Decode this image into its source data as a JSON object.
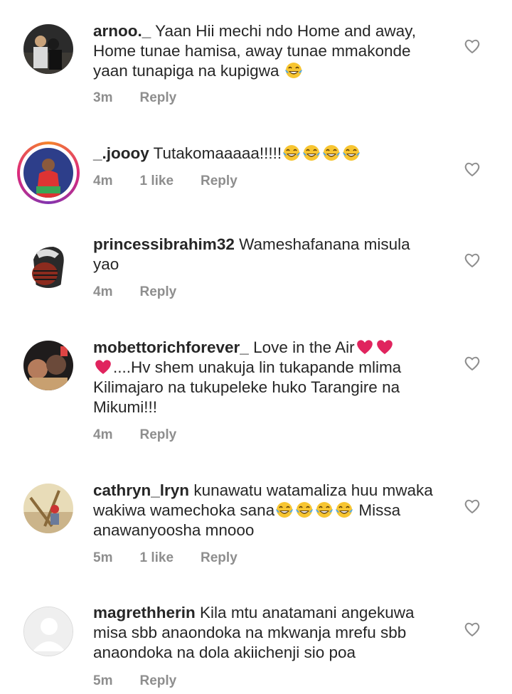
{
  "comments": [
    {
      "username": "arnoo._",
      "text_lines": [
        "Yaan Hii mechi ndo Home and away,",
        "Home tunae hamisa, away tunae mmakonde",
        "yaan tunapiga na kupigwa"
      ],
      "emoji_trailing": [
        "laughing-tears"
      ],
      "time": "3m",
      "likes": "",
      "reply": "Reply"
    },
    {
      "username": "_.joooy",
      "text_lines": [
        "Tutakomaaaaa!!!!!"
      ],
      "emoji_trailing": [
        "laughing-tears",
        "laughing-tears",
        "laughing-tears",
        "laughing-tears"
      ],
      "time": "4m",
      "likes": "1 like",
      "reply": "Reply",
      "has_story_ring": true
    },
    {
      "username": "princessibrahim32",
      "text_lines": [
        "Wameshafanana misula",
        "yao"
      ],
      "time": "4m",
      "likes": "",
      "reply": "Reply"
    },
    {
      "username": "mobettorichforever_",
      "text_lines": [
        "Love in the Air",
        "....Hv shem unakuja lin tukapande mlima",
        "Kilimajaro na tukupeleke huko Tarangire na",
        "Mikumi!!!"
      ],
      "time": "4m",
      "likes": "",
      "reply": "Reply"
    },
    {
      "username": "cathryn_lryn",
      "text_lines": [
        "kunawatu watamaliza huu mwaka",
        "wakiwa wamechoka sana",
        "Missa",
        "anawanyoosha mnooo"
      ],
      "time": "5m",
      "likes": "1 like",
      "reply": "Reply"
    },
    {
      "username": "magrethherin",
      "text_lines": [
        "Kila mtu anatamani angekuwa",
        "misa sbb anaondoka na mkwanja mrefu sbb",
        "anaondoka na dola akiichenji sio poa"
      ],
      "time": "5m",
      "likes": "",
      "reply": "Reply",
      "default_avatar": true
    }
  ],
  "colors": {
    "text": "#262626",
    "meta": "#8e8e8e",
    "heart_emoji": "#e0245e",
    "story_ring": "#dd2a7b"
  },
  "icons": {
    "like": "heart-outline-icon",
    "laugh": "laughing-tears-emoji",
    "love": "red-heart-emoji"
  }
}
